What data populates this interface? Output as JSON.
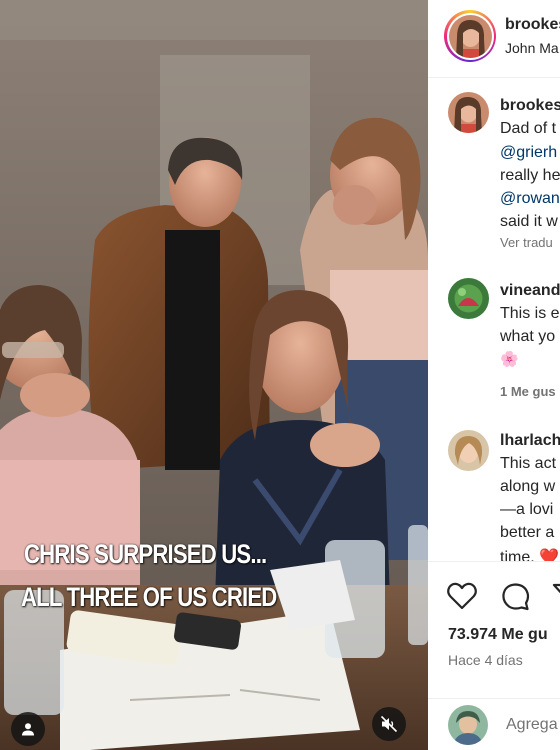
{
  "video": {
    "caption_line1": "CHRIS SURPRISED US...",
    "caption_line2": "ALL THREE OF US CRIED"
  },
  "header": {
    "username": "brookes",
    "subtitle": "John Ma"
  },
  "comments": [
    {
      "username": "brookes",
      "lines": [
        "Dad of t",
        "@grierh",
        "really he",
        "@rowan",
        "said it w"
      ],
      "meta": "Ver tradu"
    },
    {
      "username": "vineand",
      "lines": [
        "This is e",
        "what yo"
      ],
      "emoji": "🌸",
      "meta": "1 Me gus"
    },
    {
      "username": "lharlach",
      "lines": [
        "This act",
        "along w",
        "—a lovi",
        "better a",
        "time. ❤️"
      ]
    }
  ],
  "actions": {
    "likes": "73.974 Me gu",
    "date": "Hace 4 días"
  },
  "add_comment": {
    "placeholder": "Agrega"
  },
  "icons": {
    "like": "heart-icon",
    "comment": "comment-icon",
    "share": "send-icon",
    "user": "user-icon",
    "mute": "speaker-muted-icon"
  },
  "colors": {
    "mention": "#00376b",
    "muted_text": "#737373",
    "heart_red": "#e0245e"
  }
}
